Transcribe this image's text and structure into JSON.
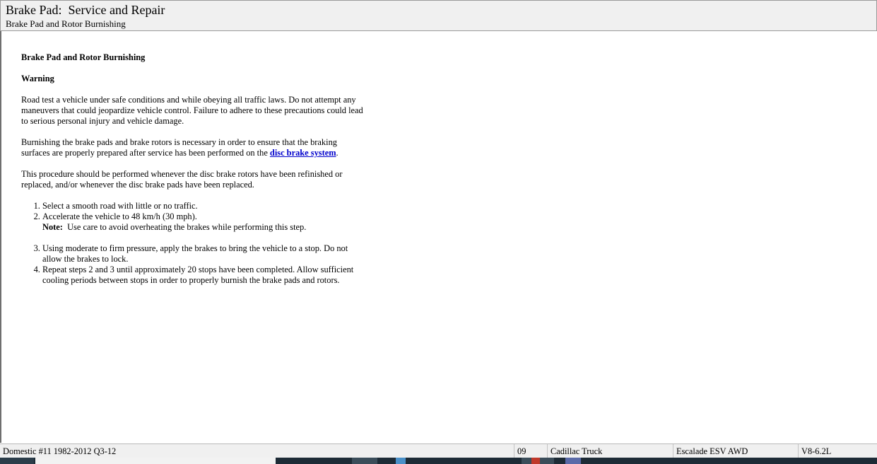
{
  "window": {
    "title": "Brake Pad:  Service and Repair",
    "subtitle": "Brake Pad and Rotor Burnishing"
  },
  "document": {
    "heading": "Brake Pad and Rotor Burnishing",
    "warning_heading": "Warning",
    "warning_text": "Road test a vehicle under safe conditions and while obeying all traffic laws. Do not attempt any maneuvers that could jeopardize vehicle control. Failure to adhere to these precautions could lead to serious personal injury and vehicle damage.",
    "para1_before_link": "Burnishing the brake pads and brake rotors is necessary in order to ensure that the braking surfaces are properly prepared after service has been performed on the ",
    "para1_link": "disc brake system",
    "para1_after_link": ".",
    "para2": "This procedure should be performed whenever the disc brake rotors have been refinished or replaced, and/or whenever the disc brake pads have been replaced.",
    "steps": [
      "Select a smooth road with little or no traffic.",
      "Accelerate the vehicle to 48 km/h (30 mph).",
      "Using moderate to firm pressure, apply the brakes to bring the vehicle to a stop. Do not allow the brakes to lock.",
      "Repeat steps 2 and 3 until approximately 20 stops have been completed. Allow sufficient cooling periods between stops in order to properly burnish the brake pads and rotors."
    ],
    "note_label": "Note:",
    "note_text": "  Use care to avoid overheating the brakes while performing this step."
  },
  "statusbar": {
    "database": "Domestic #11 1982-2012 Q3-12",
    "year": "09",
    "make": "Cadillac Truck",
    "model": "Escalade ESV AWD",
    "engine": "V8-6.2L"
  },
  "colors": {
    "link": "#0000cc",
    "chrome": "#f0f0f0",
    "taskbar": "#1d2b36"
  }
}
